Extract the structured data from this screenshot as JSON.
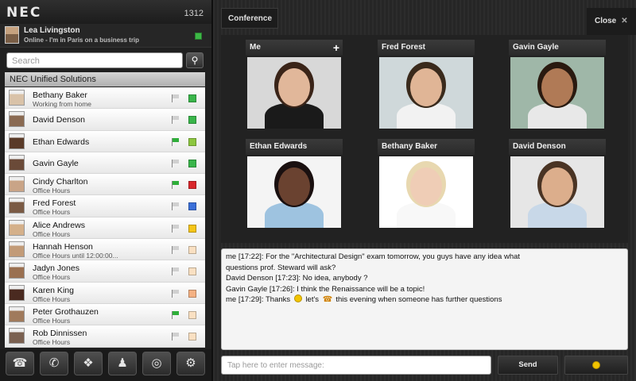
{
  "app": {
    "logo": "NEC",
    "extension": "1312"
  },
  "profile": {
    "name": "Lea Livingston",
    "status": "Online - I'm in Paris on a business trip",
    "presence_color": "#3cb846"
  },
  "search": {
    "placeholder": "Search"
  },
  "group": {
    "title": "NEC Unified Solutions"
  },
  "contacts": [
    {
      "name": "Bethany Baker",
      "status": "Working from home",
      "flag": "grey",
      "presence": "#39b54a",
      "photo": "#d9c2a8"
    },
    {
      "name": "David Denson",
      "status": "",
      "flag": "grey",
      "presence": "#39b54a",
      "photo": "#8a6a52"
    },
    {
      "name": "Ethan Edwards",
      "status": "",
      "flag": "green",
      "presence": "#8cc63f",
      "photo": "#5a3a28"
    },
    {
      "name": "Gavin Gayle",
      "status": "",
      "flag": "grey",
      "presence": "#39b54a",
      "photo": "#6a4a38"
    },
    {
      "name": "Cindy Charlton",
      "status": "Office Hours",
      "flag": "green",
      "presence": "#d9262b",
      "photo": "#c9a487"
    },
    {
      "name": "Fred Forest",
      "status": "Office Hours",
      "flag": "grey",
      "presence": "#3a6fd8",
      "photo": "#7a5a44"
    },
    {
      "name": "Alice Andrews",
      "status": "Office Hours",
      "flag": "grey",
      "presence": "#f5c518",
      "photo": "#d4b08a"
    },
    {
      "name": "Hannah Henson",
      "status": "Office Hours until 12:00:00...",
      "flag": "grey",
      "presence": "#f9e0c2",
      "photo": "#c29b78"
    },
    {
      "name": "Jadyn Jones",
      "status": "Office Hours",
      "flag": "grey",
      "presence": "#f9e0c2",
      "photo": "#9a7050"
    },
    {
      "name": "Karen King",
      "status": "Office Hours",
      "flag": "grey",
      "presence": "#f4b183",
      "photo": "#4a2a20"
    },
    {
      "name": "Peter Grothauzen",
      "status": "Office Hours",
      "flag": "green",
      "presence": "#f9e0c2",
      "photo": "#a07a5c"
    },
    {
      "name": "Rob Dinnissen",
      "status": "Office Hours",
      "flag": "grey",
      "presence": "#f9e0c2",
      "photo": "#7a6050"
    }
  ],
  "bottom_nav": [
    {
      "icon": "phone-icon",
      "glyph": "☎"
    },
    {
      "icon": "call-forward-icon",
      "glyph": "✆"
    },
    {
      "icon": "chat-bubbles-icon",
      "glyph": "❖"
    },
    {
      "icon": "group-icon",
      "glyph": "♟"
    },
    {
      "icon": "voicemail-icon",
      "glyph": "◎"
    },
    {
      "icon": "settings-gear-icon",
      "glyph": "⚙"
    }
  ],
  "conference": {
    "tab_label": "Conference",
    "close_label": "Close",
    "participants": [
      {
        "name": "Me",
        "skin": "#e1b79a",
        "hair": "#3a2418",
        "shirt": "#1a1a1a",
        "bg": "#d8d8d8"
      },
      {
        "name": "Fred Forest",
        "skin": "#e0b596",
        "hair": "#3a2a1c",
        "shirt": "#f2f2f2",
        "bg": "#cfd8da"
      },
      {
        "name": "Gavin Gayle",
        "skin": "#b07a56",
        "hair": "#2a1a10",
        "shirt": "#e8e8e8",
        "bg": "#9fb7a8"
      },
      {
        "name": "Ethan Edwards",
        "skin": "#6a4230",
        "hair": "#1a1010",
        "shirt": "#9ec3e0",
        "bg": "#f4f4f4"
      },
      {
        "name": "Bethany Baker",
        "skin": "#efcdb6",
        "hair": "#e8d8b0",
        "shirt": "#f8f8f8",
        "bg": "#ffffff"
      },
      {
        "name": "David Denson",
        "skin": "#dcae8c",
        "hair": "#4a3424",
        "shirt": "#c8d8e8",
        "bg": "#e6e6e6"
      }
    ]
  },
  "chat": {
    "lines": [
      {
        "text": "me [17:22]: For the \"Architectural Design\" exam tomorrow, you guys have any idea what"
      },
      {
        "text": "questions prof. Steward will ask?"
      },
      {
        "text": "David Denson [17:23]: No idea, anybody ?"
      },
      {
        "text": "Gavin Gayle [17:26]: I think the Renaissance will be a topic!"
      }
    ],
    "last_line": {
      "part1": "me [17:29]: Thanks ",
      "part2": " let's ",
      "part3": " this evening when someone has further questions"
    }
  },
  "composer": {
    "placeholder": "Tap here to enter message:",
    "send_label": "Send"
  }
}
